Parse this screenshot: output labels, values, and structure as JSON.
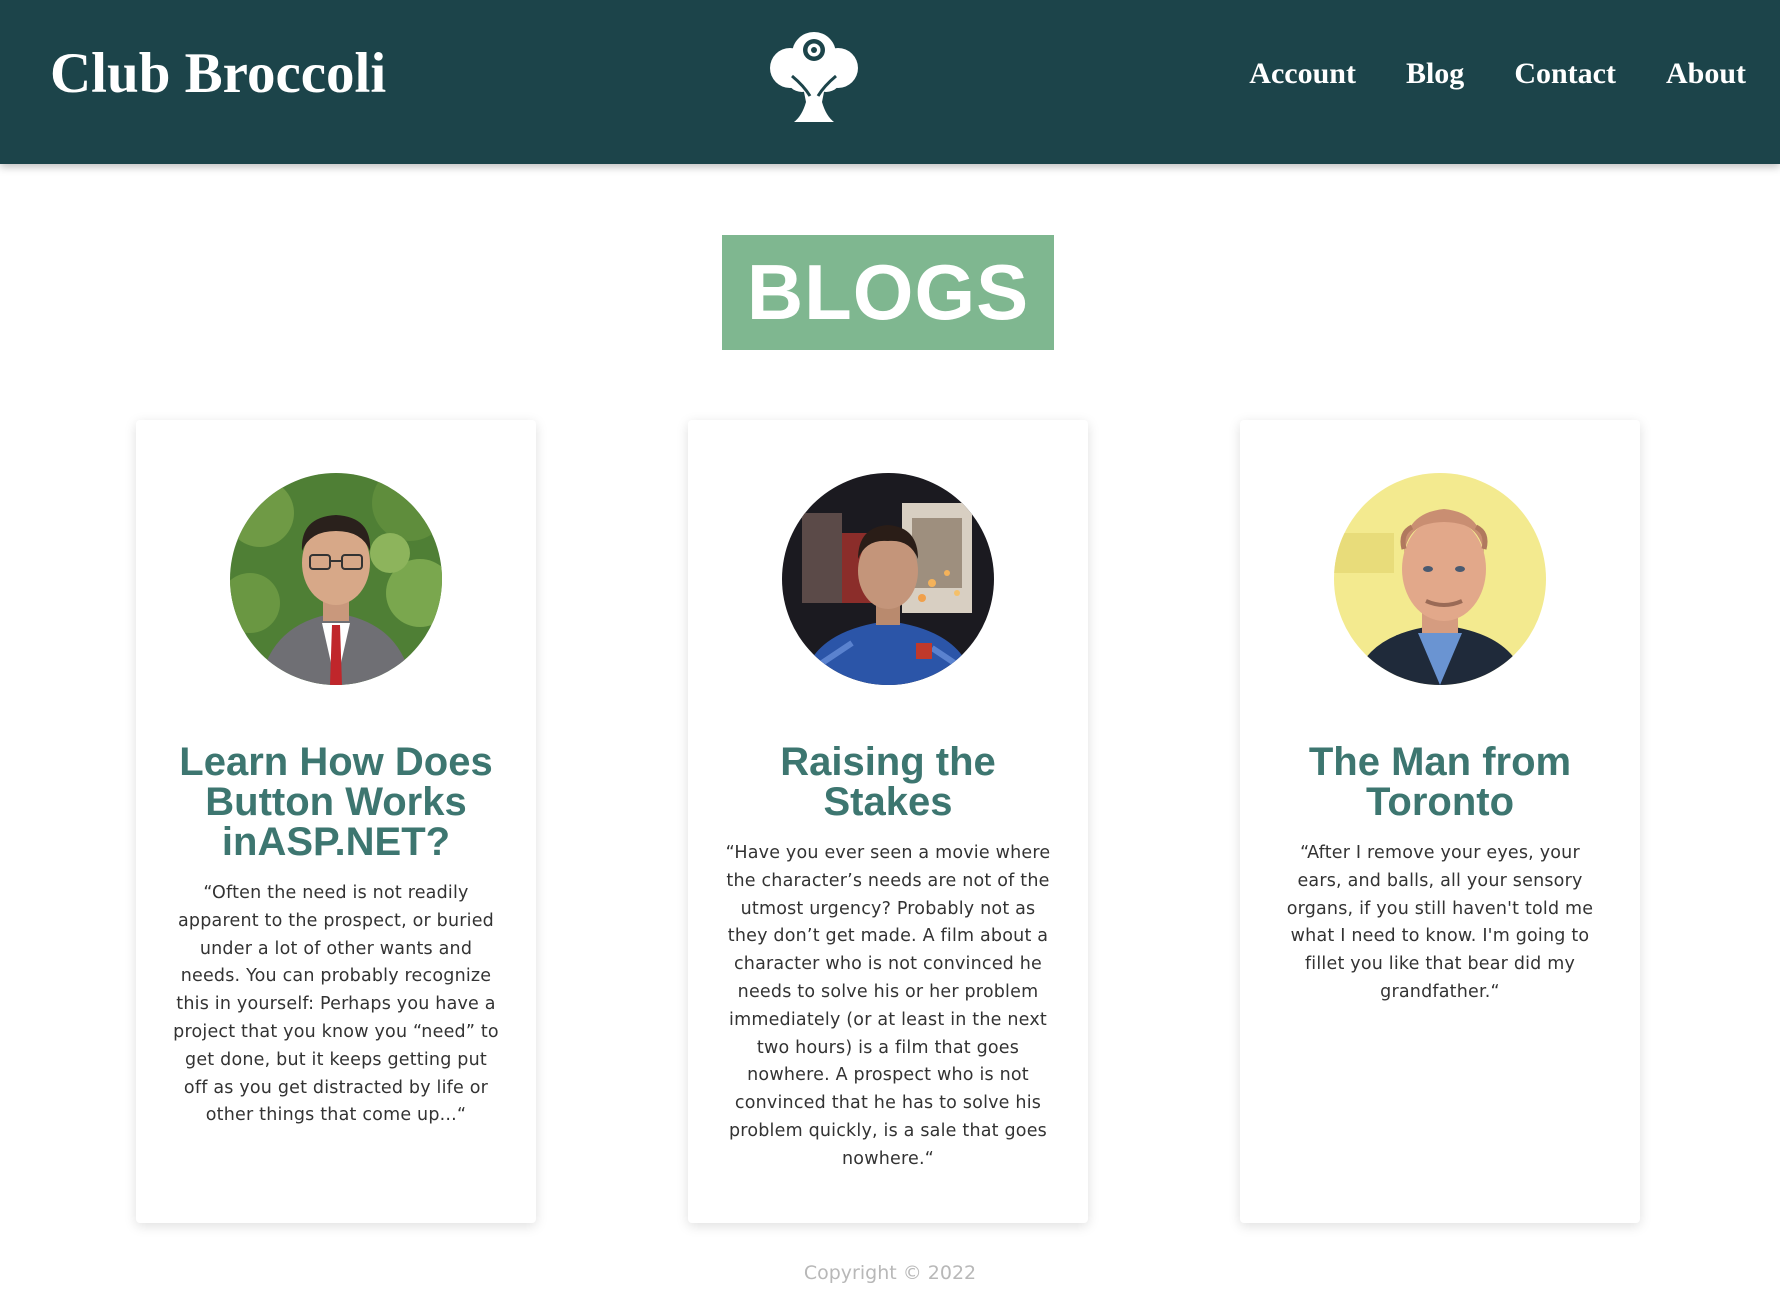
{
  "header": {
    "brand": "Club Broccoli",
    "logo_icon": "broccoli-icon",
    "nav": [
      {
        "label": "Account"
      },
      {
        "label": "Blog"
      },
      {
        "label": "Contact"
      },
      {
        "label": "About"
      }
    ]
  },
  "main": {
    "title": "BLOGS",
    "posts": [
      {
        "title": "Learn How Does Button Works inASP.NET?",
        "excerpt": "“Often the need is not readily apparent to the prospect, or buried under a lot of other wants and needs. You can probably recognize this in yourself: Perhaps you have a project that you know you “need” to get done, but it keeps getting put off as you get distracted by life or other things that come up...“",
        "avatar_icon": "author-avatar"
      },
      {
        "title": "Raising the Stakes",
        "excerpt": "“Have you ever seen a movie where the character’s needs are not of the utmost urgency? Probably not as they don’t get made. A film about a character who is not convinced he needs to solve his or her problem immediately (or at least in the next two hours) is a film that goes nowhere. A prospect who is not convinced that he has to solve his problem quickly, is a sale that goes nowhere.“",
        "avatar_icon": "author-avatar"
      },
      {
        "title": "The Man from Toronto",
        "excerpt": "“After I remove your eyes, your ears, and balls, all your sensory organs, if you still haven't told me what I need to know. I'm going to fillet you like that bear did my grandfather.“",
        "avatar_icon": "author-avatar"
      }
    ]
  },
  "footer": {
    "copyright": "Copyright © 2022"
  },
  "colors": {
    "header_bg": "#1c444a",
    "title_bg": "#7fb790",
    "card_title": "#3d7670"
  }
}
